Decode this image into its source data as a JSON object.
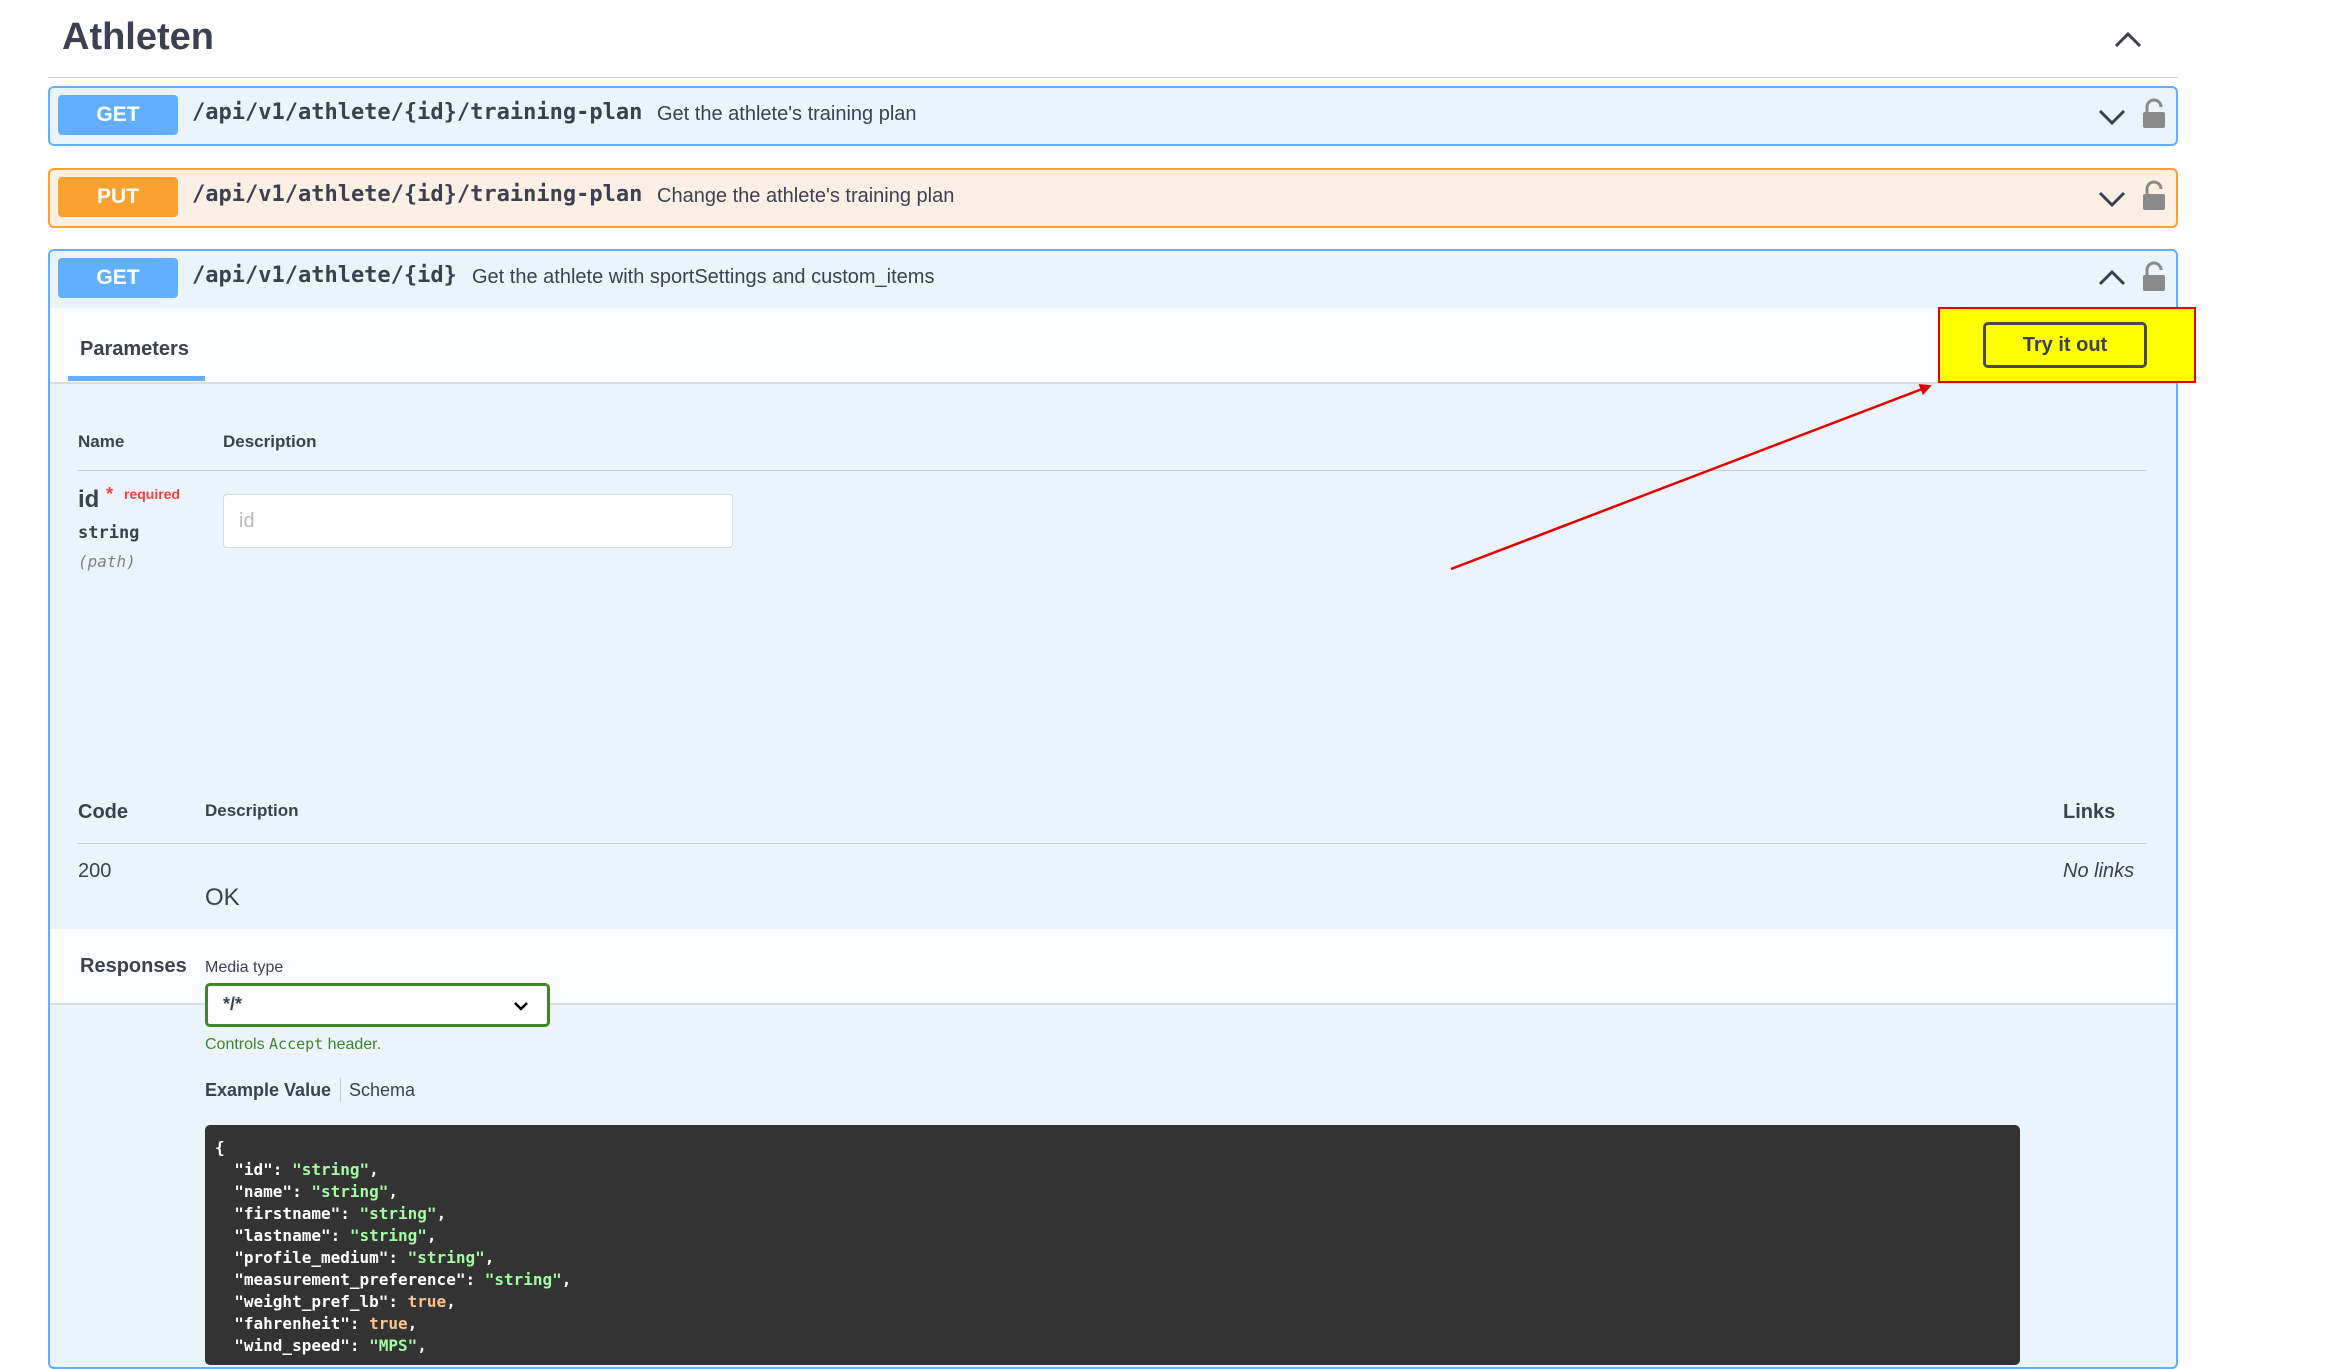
{
  "section": {
    "title": "Athleten"
  },
  "operations": [
    {
      "method": "GET",
      "path": "/api/v1/athlete/{id}/training-plan",
      "summary": "Get the athlete's training plan"
    },
    {
      "method": "PUT",
      "path": "/api/v1/athlete/{id}/training-plan",
      "summary": "Change the athlete's training plan"
    },
    {
      "method": "GET",
      "path": "/api/v1/athlete/{id}",
      "summary": "Get the athlete with sportSettings and custom_items"
    }
  ],
  "expanded": {
    "tab_parameters": "Parameters",
    "try_button": "Try it out",
    "param_headers": {
      "name": "Name",
      "description": "Description"
    },
    "param": {
      "name": "id",
      "star": "*",
      "required": "required",
      "type": "string",
      "in": "(path)",
      "placeholder": "id"
    },
    "responses_title": "Responses",
    "resp_headers": {
      "code": "Code",
      "description": "Description",
      "links": "Links"
    },
    "response": {
      "code": "200",
      "description": "OK",
      "links": "No links",
      "media_type_label": "Media type",
      "media_type_value": "*/*",
      "controls_prefix": "Controls",
      "controls_code": "Accept",
      "controls_suffix": "header.",
      "example_tab": "Example Value",
      "schema_tab": "Schema",
      "example_open": "{",
      "example_lines": [
        {
          "key": "\"id\"",
          "value": "\"string\"",
          "kind": "s"
        },
        {
          "key": "\"name\"",
          "value": "\"string\"",
          "kind": "s"
        },
        {
          "key": "\"firstname\"",
          "value": "\"string\"",
          "kind": "s"
        },
        {
          "key": "\"lastname\"",
          "value": "\"string\"",
          "kind": "s"
        },
        {
          "key": "\"profile_medium\"",
          "value": "\"string\"",
          "kind": "s"
        },
        {
          "key": "\"measurement_preference\"",
          "value": "\"string\"",
          "kind": "s"
        },
        {
          "key": "\"weight_pref_lb\"",
          "value": "true",
          "kind": "b"
        },
        {
          "key": "\"fahrenheit\"",
          "value": "true",
          "kind": "b"
        },
        {
          "key": "\"wind_speed\"",
          "value": "\"MPS\"",
          "kind": "s"
        }
      ]
    }
  },
  "colors": {
    "get": "#61affe",
    "put": "#fca130",
    "highlight": "#ffff00",
    "annotation": "#e00000",
    "success": "#41852a",
    "required": "#f93e3e"
  },
  "icons": [
    "chevron-up-icon",
    "chevron-down-icon",
    "lock-icon",
    "arrow-annotation"
  ]
}
